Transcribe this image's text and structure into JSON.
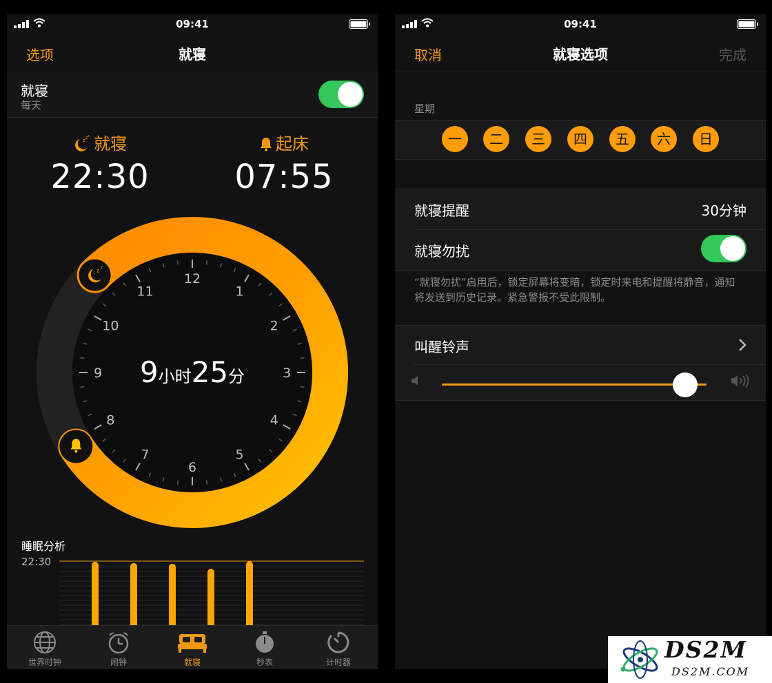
{
  "left": {
    "status": {
      "time": "09:41"
    },
    "nav": {
      "left": "选项",
      "title": "就寝"
    },
    "bedtime_row": {
      "title": "就寝",
      "subtitle": "每天",
      "toggle_on": true
    },
    "bedtime": {
      "label": "就寝",
      "time": "22:30"
    },
    "wake": {
      "label": "起床",
      "time": "07:55"
    },
    "dial": {
      "duration_hours": "9",
      "hours_unit": "小时",
      "duration_minutes": "25",
      "minutes_unit": "分",
      "hour_numbers": [
        "12",
        "1",
        "2",
        "3",
        "4",
        "5",
        "6",
        "7",
        "8",
        "9",
        "10",
        "11"
      ]
    },
    "analysis": {
      "title": "睡眠分析",
      "time": "22:30",
      "bars": [
        0.99,
        0.97,
        0.96,
        0.88,
        1.0
      ]
    },
    "tabs": [
      {
        "label": "世界时钟",
        "icon": "globe-icon"
      },
      {
        "label": "闹钟",
        "icon": "alarm-clock-icon"
      },
      {
        "label": "就寝",
        "icon": "bed-icon",
        "active": true
      },
      {
        "label": "秒表",
        "icon": "stopwatch-icon"
      },
      {
        "label": "计时器",
        "icon": "timer-icon"
      }
    ]
  },
  "right": {
    "status": {
      "time": "09:41"
    },
    "nav": {
      "left": "取消",
      "title": "就寝选项",
      "right": "完成"
    },
    "days_label": "星期",
    "days": [
      "一",
      "二",
      "三",
      "四",
      "五",
      "六",
      "日"
    ],
    "reminder": {
      "label": "就寝提醒",
      "value": "30分钟"
    },
    "dnd": {
      "label": "就寝勿扰",
      "toggle_on": true
    },
    "footnote": "“就寝勿扰”启用后，锁定屏幕将变暗，锁定时来电和提醒将静音，通知将发送到历史记录。紧急警报不受此限制。",
    "sound": {
      "label": "叫醒铃声"
    },
    "volume": {
      "level": 0.92
    }
  },
  "watermark": {
    "text": "DS2M",
    "sub": "DS2M.COM"
  },
  "colors": {
    "accent": "#f09a13",
    "toggle": "#34c759",
    "background": "#121212"
  }
}
